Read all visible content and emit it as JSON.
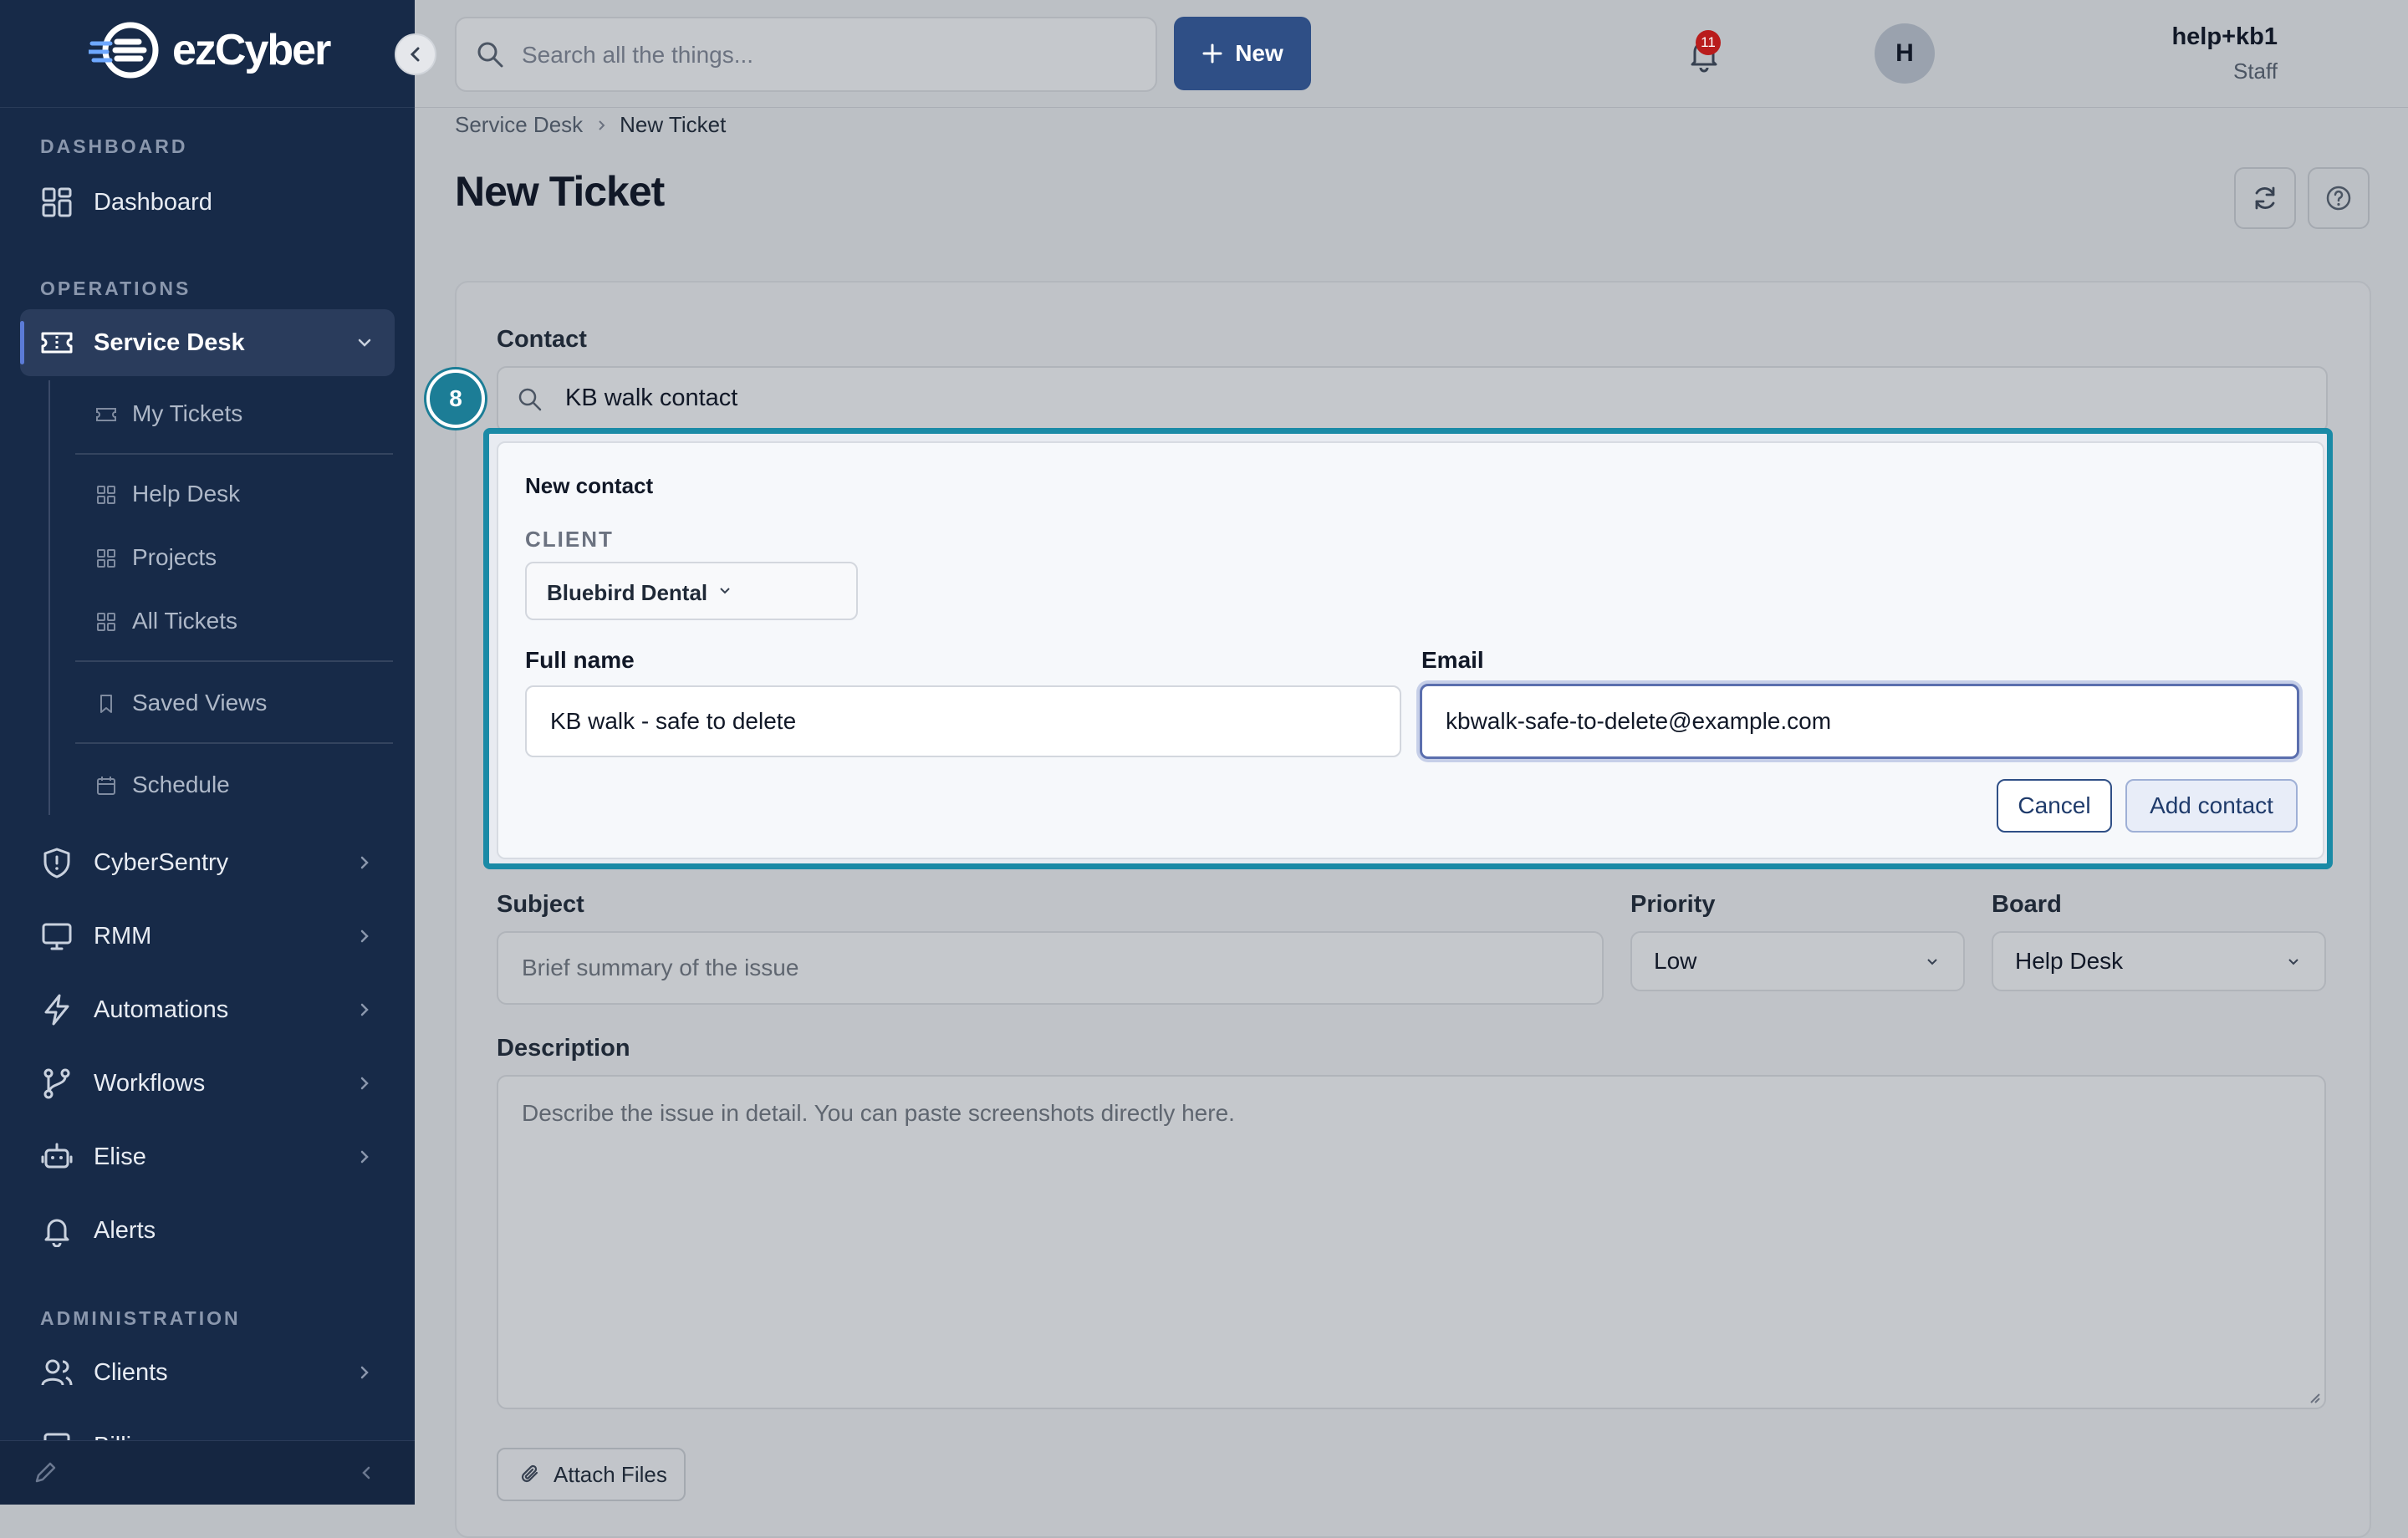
{
  "app": {
    "logo_text": "ezCyber"
  },
  "sidebar": {
    "sections": {
      "dashboard": "DASHBOARD",
      "operations": "OPERATIONS",
      "administration": "ADMINISTRATION"
    },
    "items": {
      "dashboard": "Dashboard",
      "service_desk": "Service Desk",
      "cybersentry": "CyberSentry",
      "rmm": "RMM",
      "automations": "Automations",
      "workflows": "Workflows",
      "elise": "Elise",
      "alerts": "Alerts",
      "clients": "Clients",
      "billing": "Billing"
    },
    "sub_items": {
      "my_tickets": "My Tickets",
      "help_desk": "Help Desk",
      "projects": "Projects",
      "all_tickets": "All Tickets",
      "saved_views": "Saved Views",
      "schedule": "Schedule"
    }
  },
  "topbar": {
    "search_placeholder": "Search all the things...",
    "new_label": "New",
    "notifications_count": "11",
    "user_name": "help+kb1",
    "user_role": "Staff",
    "avatar_initial": "H"
  },
  "breadcrumb": {
    "parent": "Service Desk",
    "current": "New Ticket"
  },
  "page": {
    "title": "New Ticket"
  },
  "form": {
    "contact_label": "Contact",
    "contact_value": "KB walk contact",
    "step_number": "8",
    "new_contact": {
      "title": "New contact",
      "client_label": "CLIENT",
      "client_value": "Bluebird Dental",
      "full_name_label": "Full name",
      "full_name_value": "KB walk - safe to delete",
      "email_label": "Email",
      "email_value": "kbwalk-safe-to-delete@example.com",
      "cancel_label": "Cancel",
      "add_label": "Add contact"
    },
    "subject_label": "Subject",
    "subject_placeholder": "Brief summary of the issue",
    "priority_label": "Priority",
    "priority_value": "Low",
    "board_label": "Board",
    "board_value": "Help Desk",
    "description_label": "Description",
    "description_placeholder": "Describe the issue in detail. You can paste screenshots directly here.",
    "attach_label": "Attach Files"
  },
  "colors": {
    "sidebar_bg": "#172a48",
    "primary": "#2f4f86",
    "highlight": "#1a8aa6",
    "badge": "#b91c1c"
  }
}
